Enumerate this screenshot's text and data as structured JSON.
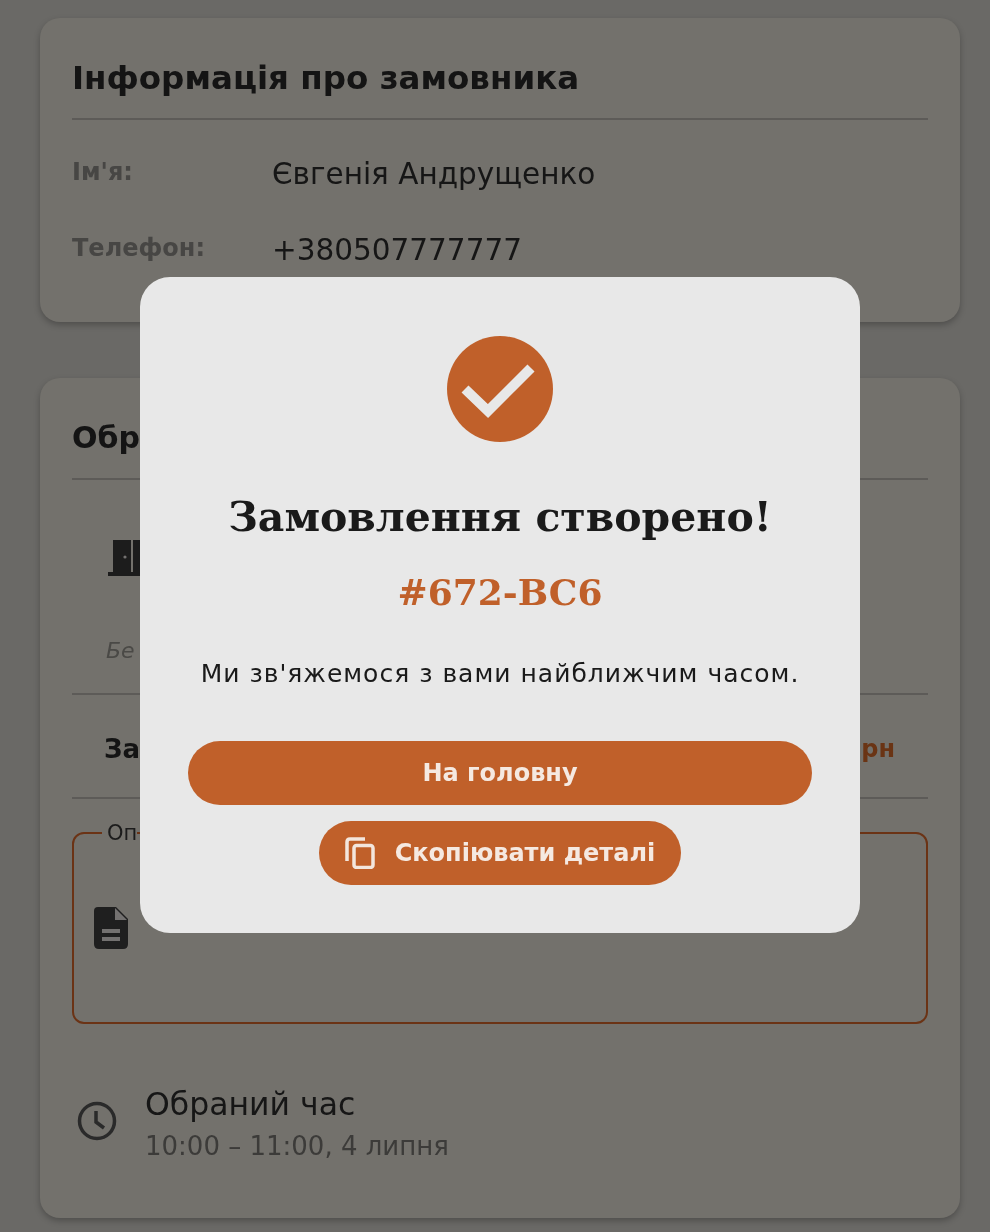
{
  "customer_card": {
    "title": "Інформація про замовника",
    "fields": [
      {
        "label": "Ім'я:",
        "value": "Євгенія Андрущенко"
      },
      {
        "label": "Телефон:",
        "value": "+380507777777"
      }
    ]
  },
  "order_card": {
    "title": "Обр",
    "note": "Бе",
    "total": {
      "label": "За",
      "value": "рн"
    },
    "comment_field": {
      "legend": "Оп"
    },
    "time": {
      "label": "Обраний час",
      "value": "10:00 – 11:00, 4 липня"
    }
  },
  "dialog": {
    "title": "Замовлення створено!",
    "order_number": "#672-BC6",
    "message": "Ми зв'яжемося з вами найближчим часом.",
    "buttons": [
      {
        "kind": "primary",
        "label": "На головну"
      },
      {
        "kind": "copy",
        "label": "Скопіювати деталі"
      }
    ]
  }
}
